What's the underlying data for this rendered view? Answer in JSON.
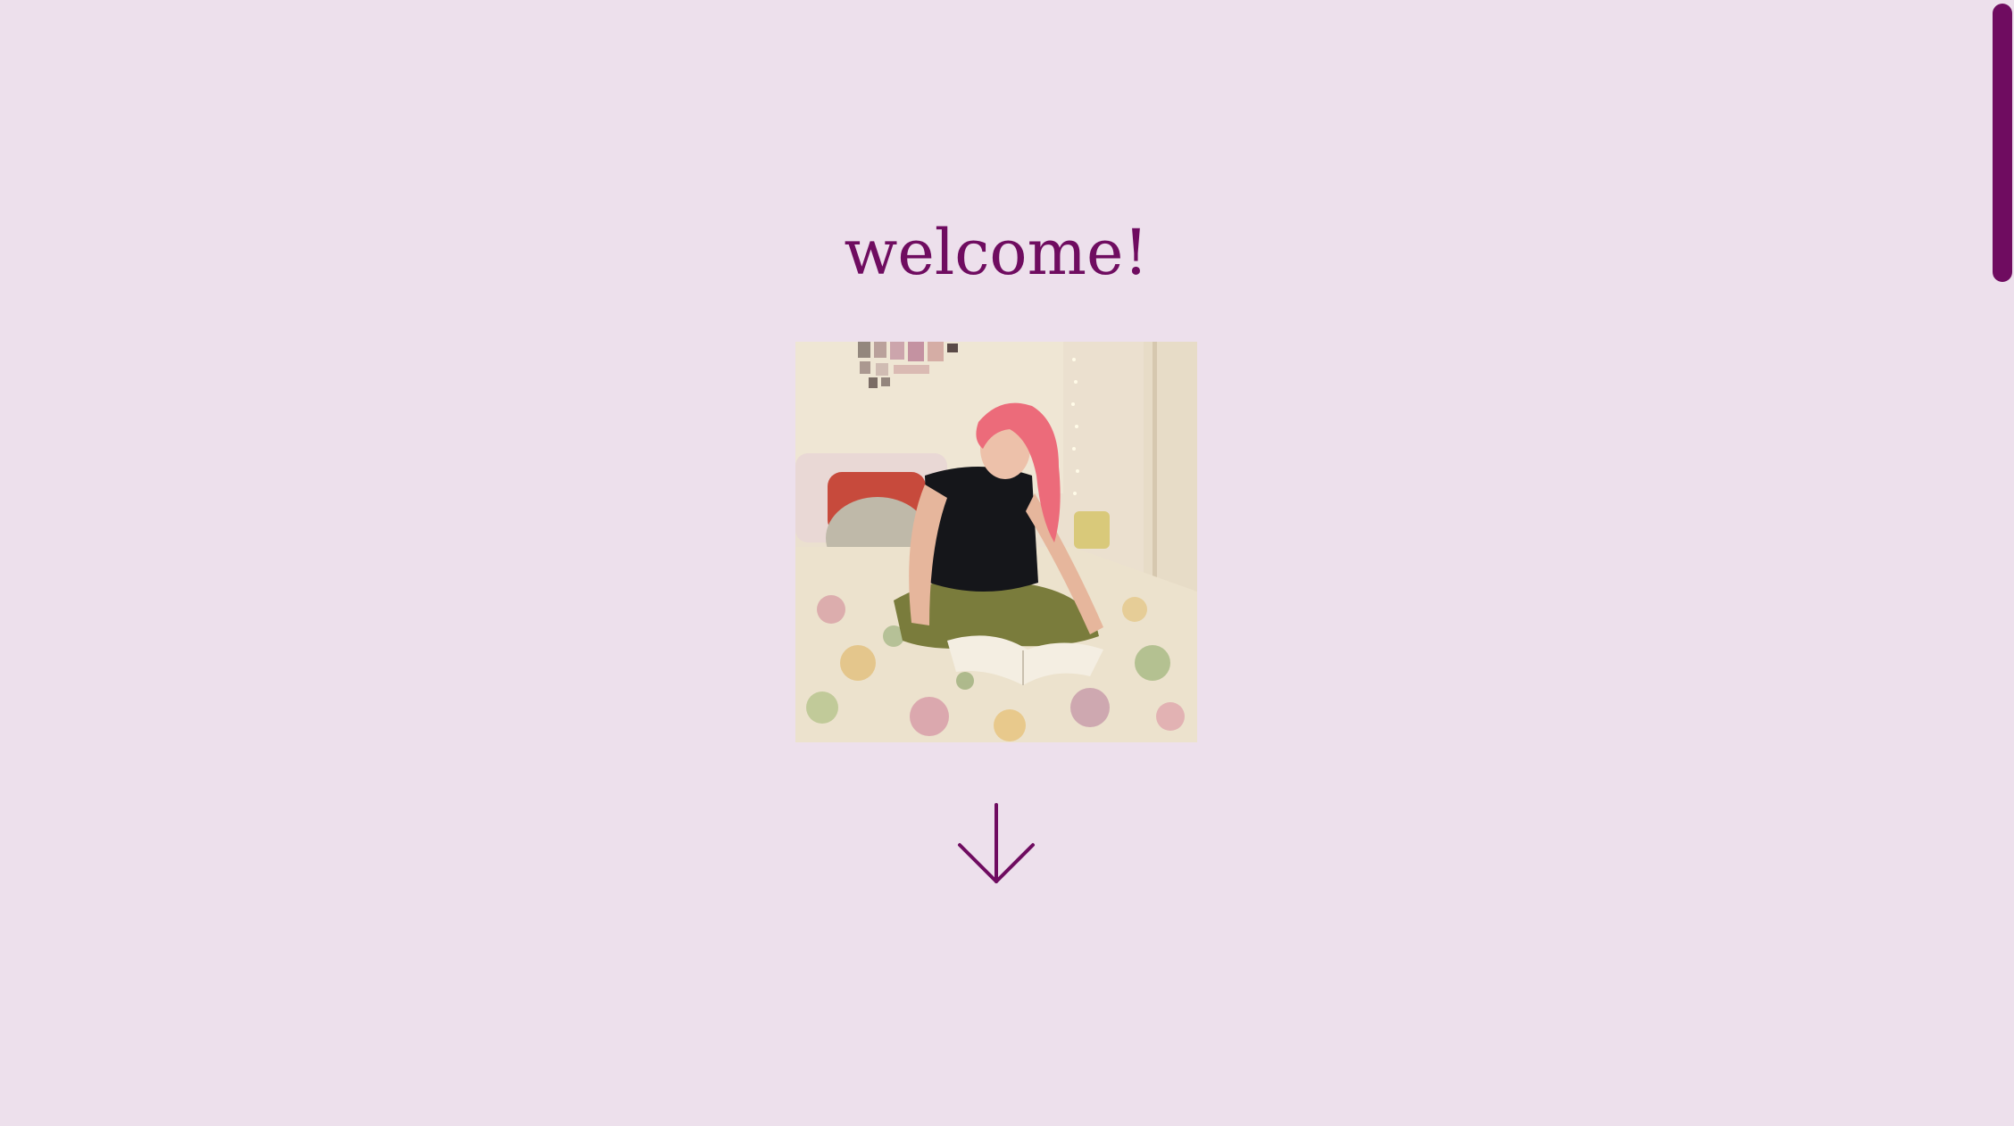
{
  "page": {
    "heading": "welcome!"
  },
  "photo": {
    "subject": "person-reading-on-bed"
  },
  "icons": {
    "down_arrow": "arrow-down-icon"
  },
  "colors": {
    "background": "#ede0ec",
    "accent": "#6f0c60"
  }
}
